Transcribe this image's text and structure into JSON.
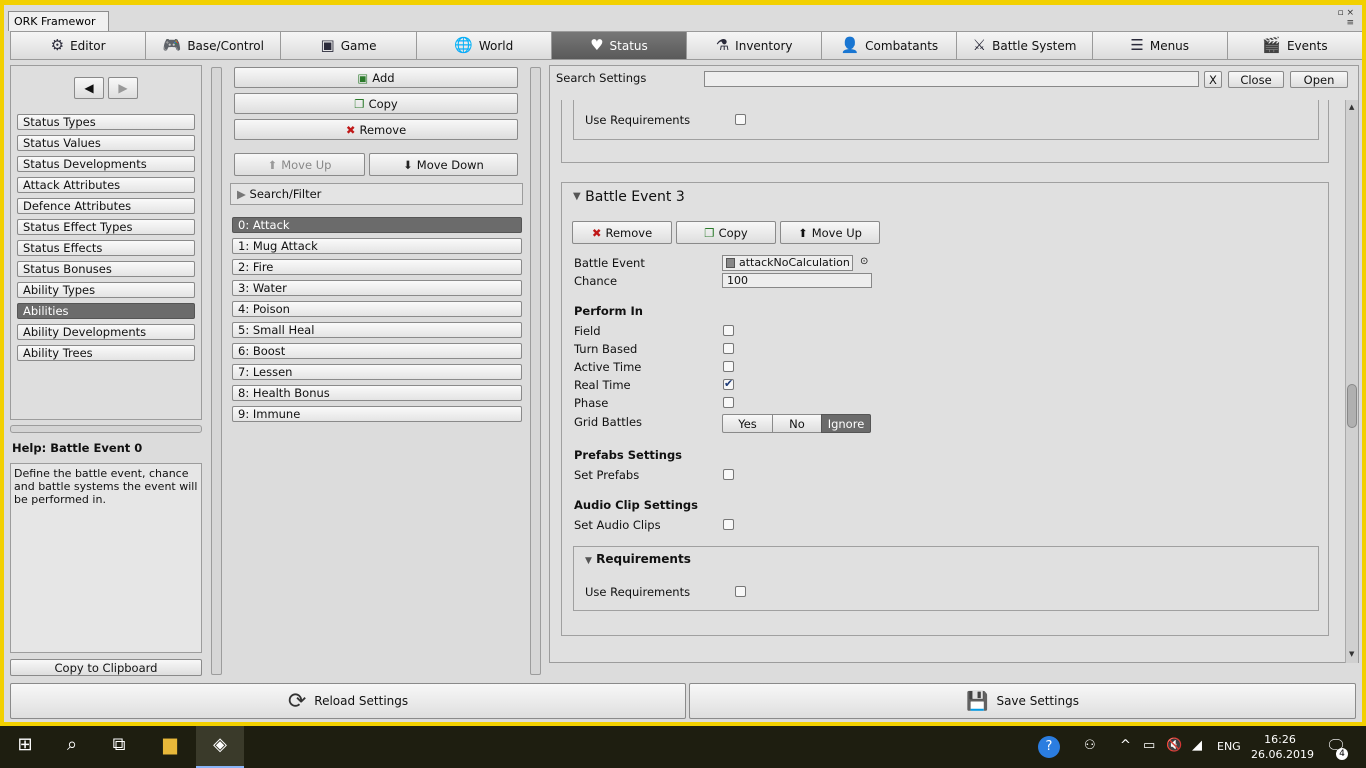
{
  "window": {
    "title": "ORK Framewor",
    "controls": [
      "▫",
      "×",
      "≡"
    ]
  },
  "tabs": [
    {
      "label": "Editor",
      "icon": "gear-icon",
      "glyph": "⚙"
    },
    {
      "label": "Base/Control",
      "icon": "gamepad-icon",
      "glyph": "🎮"
    },
    {
      "label": "Game",
      "icon": "cube-icon",
      "glyph": "▣"
    },
    {
      "label": "World",
      "icon": "globe-icon",
      "glyph": "🌐"
    },
    {
      "label": "Status",
      "icon": "heart-icon",
      "glyph": "♥"
    },
    {
      "label": "Inventory",
      "icon": "potion-icon",
      "glyph": "⚗"
    },
    {
      "label": "Combatants",
      "icon": "person-icon",
      "glyph": "👤"
    },
    {
      "label": "Battle System",
      "icon": "sword-icon",
      "glyph": "⚔"
    },
    {
      "label": "Menus",
      "icon": "menu-icon",
      "glyph": "☰"
    },
    {
      "label": "Events",
      "icon": "clapper-icon",
      "glyph": "🎬"
    }
  ],
  "active_tab": "Status",
  "nav": {
    "back_glyph": "◀",
    "forward_glyph": "▶",
    "items": [
      "Status Types",
      "Status Values",
      "Status Developments",
      "Attack Attributes",
      "Defence Attributes",
      "Status Effect Types",
      "Status Effects",
      "Status Bonuses",
      "Ability Types",
      "Abilities",
      "Ability Developments",
      "Ability Trees"
    ],
    "selected": "Abilities"
  },
  "help": {
    "title": "Help: Battle Event 0",
    "text": "Define the battle event, chance and battle systems the event will be performed in.",
    "copy_button": "Copy to Clipboard"
  },
  "list_panel": {
    "add": "Add",
    "copy": "Copy",
    "remove": "Remove",
    "move_up": "Move Up",
    "move_down": "Move Down",
    "search_filter": "Search/Filter",
    "items": [
      "0: Attack",
      "1: Mug Attack",
      "2: Fire",
      "3: Water",
      "4: Poison",
      "5: Small Heal",
      "6: Boost",
      "7: Lessen",
      "8: Health Bonus",
      "9: Immune"
    ],
    "selected": "0: Attack"
  },
  "search": {
    "label": "Search Settings",
    "value": "",
    "clear": "X",
    "close": "Close",
    "open": "Open"
  },
  "top_section": {
    "use_requirements_label": "Use Requirements",
    "use_requirements": false
  },
  "battle_event": {
    "title": "Battle Event 3",
    "remove": "Remove",
    "copy": "Copy",
    "move_up": "Move Up",
    "event_label": "Battle Event",
    "event_value": "attackNoCalculation",
    "chance_label": "Chance",
    "chance_value": "100",
    "perform_in_title": "Perform In",
    "perform_in": [
      {
        "label": "Field",
        "checked": false
      },
      {
        "label": "Turn Based",
        "checked": false
      },
      {
        "label": "Active Time",
        "checked": false
      },
      {
        "label": "Real Time",
        "checked": true
      },
      {
        "label": "Phase",
        "checked": false
      }
    ],
    "grid_battles_label": "Grid Battles",
    "grid_options": [
      "Yes",
      "No",
      "Ignore"
    ],
    "grid_selected": "Ignore",
    "prefabs_title": "Prefabs Settings",
    "set_prefabs_label": "Set Prefabs",
    "audio_title": "Audio Clip Settings",
    "set_audio_label": "Set Audio Clips",
    "requirements_title": "Requirements",
    "use_requirements_label": "Use Requirements",
    "use_requirements": false
  },
  "footer": {
    "reload": "Reload Settings",
    "save": "Save Settings"
  },
  "taskbar": {
    "time": "16:26",
    "date": "26.06.2019",
    "lang": "ENG",
    "notifications": "4"
  },
  "colors": {
    "selected_bg": "#6b6b6b",
    "frame": "#f2d000",
    "taskbar": "#1e1e10"
  }
}
